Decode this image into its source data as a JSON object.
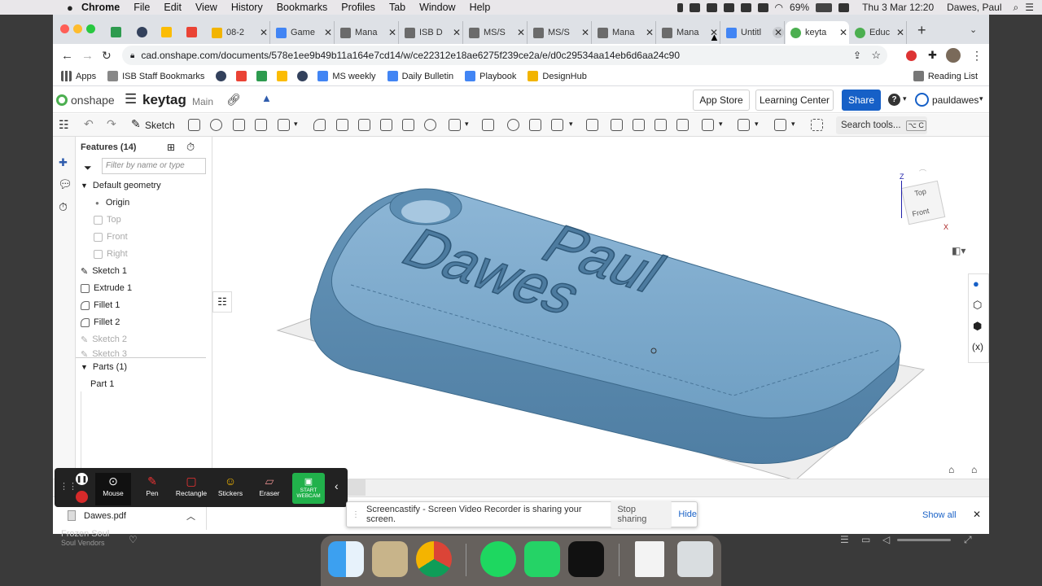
{
  "menubar": {
    "items": [
      "Chrome",
      "File",
      "Edit",
      "View",
      "History",
      "Bookmarks",
      "Profiles",
      "Tab",
      "Window",
      "Help"
    ],
    "battery": "69%",
    "clock": "Thu 3 Mar  12:20",
    "user": "Dawes, Paul"
  },
  "tabs": [
    {
      "label": "08-2",
      "color": "#f2b400"
    },
    {
      "label": "Game",
      "color": "#4285f4"
    },
    {
      "label": "Mana",
      "color": "#6b6b6b"
    },
    {
      "label": "ISB D",
      "color": "#6b6b6b"
    },
    {
      "label": "MS/S",
      "color": "#6b6b6b"
    },
    {
      "label": "MS/S",
      "color": "#6b6b6b"
    },
    {
      "label": "Mana",
      "color": "#6b6b6b"
    },
    {
      "label": "Mana",
      "color": "#6b6b6b"
    },
    {
      "label": "Untitl",
      "color": "#4285f4"
    },
    {
      "label": "keyta",
      "color": "#4caf50"
    },
    {
      "label": "Educ",
      "color": "#4caf50"
    }
  ],
  "address": {
    "url": "cad.onshape.com/documents/578e1ee9b49b11a164e7cd14/w/ce22312e18ae6275f239ce2a/e/d0c29534aa14eb6d6aa24c90"
  },
  "bookmarks": {
    "items": [
      "Apps",
      "ISB Staff Bookmarks",
      "MS weekly",
      "Daily Bulletin",
      "Playbook",
      "DesignHub"
    ],
    "reading_list": "Reading List"
  },
  "onshape": {
    "brand": "onshape",
    "doc_title": "keytag",
    "workspace": "Main",
    "app_store": "App Store",
    "learning_center": "Learning Center",
    "share": "Share",
    "user": "pauldawes",
    "sketch": "Sketch",
    "search_tools": "Search tools...",
    "search_shortcut": "⌥ C"
  },
  "features": {
    "header": "Features (14)",
    "filter_placeholder": "Filter by name or type",
    "default_geometry": "Default geometry",
    "items": [
      {
        "label": "Origin",
        "dim": false
      },
      {
        "label": "Top",
        "dim": true
      },
      {
        "label": "Front",
        "dim": true
      },
      {
        "label": "Right",
        "dim": true
      },
      {
        "label": "Sketch 1",
        "dim": false
      },
      {
        "label": "Extrude 1",
        "dim": false
      },
      {
        "label": "Fillet 1",
        "dim": false
      },
      {
        "label": "Fillet 2",
        "dim": false
      },
      {
        "label": "Sketch 2",
        "dim": true
      },
      {
        "label": "Sketch 3",
        "dim": true
      }
    ],
    "parts_header": "Parts (1)",
    "part": "Part 1"
  },
  "model": {
    "line1": "Paul",
    "line2": "Dawes",
    "color": "#6f9fc3"
  },
  "viewcube": {
    "top": "Top",
    "front": "Front",
    "z": "Z",
    "x": "X"
  },
  "screencastify": {
    "tools": [
      "Mouse",
      "Pen",
      "Rectangle",
      "Stickers",
      "Eraser"
    ],
    "webcam_line1": "START",
    "webcam_line2": "WEBCAM"
  },
  "share_notice": {
    "text": "Screencastify - Screen Video Recorder is sharing your screen.",
    "stop": "Stop sharing",
    "hide": "Hide"
  },
  "downloads": {
    "file": "Dawes.pdf",
    "show_all": "Show all"
  },
  "music": {
    "title": "Frozen Soul",
    "artist": "Soul Vendors"
  }
}
